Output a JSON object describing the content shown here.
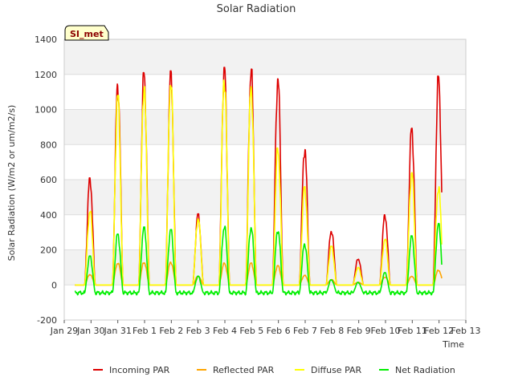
{
  "chart_data": {
    "type": "line",
    "title": "Solar Radiation",
    "xlabel": "Time",
    "ylabel": "Solar Radiation (W/m2 or um/m2/s)",
    "badge": "SI_met",
    "ylim": [
      -200,
      1400
    ],
    "yticks": [
      -200,
      0,
      200,
      400,
      600,
      800,
      1000,
      1200,
      1400
    ],
    "xlim": [
      0,
      15
    ],
    "xticks": [
      {
        "x": 0,
        "label": "Jan 29"
      },
      {
        "x": 1,
        "label": "Jan 30"
      },
      {
        "x": 2,
        "label": "Jan 31"
      },
      {
        "x": 3,
        "label": "Feb 1"
      },
      {
        "x": 4,
        "label": "Feb 2"
      },
      {
        "x": 5,
        "label": "Feb 3"
      },
      {
        "x": 6,
        "label": "Feb 4"
      },
      {
        "x": 7,
        "label": "Feb 5"
      },
      {
        "x": 8,
        "label": "Feb 6"
      },
      {
        "x": 9,
        "label": "Feb 7"
      },
      {
        "x": 10,
        "label": "Feb 8"
      },
      {
        "x": 11,
        "label": "Feb 9"
      },
      {
        "x": 12,
        "label": "Feb 10"
      },
      {
        "x": 13,
        "label": "Feb 11"
      },
      {
        "x": 14,
        "label": "Feb 12"
      },
      {
        "x": 15,
        "label": "Feb 13"
      }
    ],
    "start": 0.4,
    "end": 14.1,
    "grid": true,
    "legend_position": "bottom",
    "series": [
      {
        "name": "Incoming PAR",
        "color": "#dd0000",
        "night": 0,
        "peaks": [
          [
            0.96,
            610
          ],
          [
            2.0,
            1145
          ],
          [
            2.98,
            1210
          ],
          [
            3.98,
            1220
          ],
          [
            5.0,
            405
          ],
          [
            5.98,
            1240
          ],
          [
            6.98,
            1230
          ],
          [
            7.98,
            1178
          ],
          [
            8.98,
            780
          ],
          [
            9.98,
            310
          ],
          [
            10.98,
            150
          ],
          [
            11.98,
            400
          ],
          [
            12.98,
            893
          ],
          [
            13.98,
            1190
          ]
        ]
      },
      {
        "name": "Reflected PAR",
        "color": "#ffa500",
        "night": 0,
        "peaks": [
          [
            0.96,
            60
          ],
          [
            2.0,
            125
          ],
          [
            2.98,
            130
          ],
          [
            3.98,
            130
          ],
          [
            5.0,
            50
          ],
          [
            5.98,
            125
          ],
          [
            6.98,
            125
          ],
          [
            7.98,
            110
          ],
          [
            8.98,
            55
          ],
          [
            9.98,
            30
          ],
          [
            10.98,
            15
          ],
          [
            11.98,
            45
          ],
          [
            12.98,
            50
          ],
          [
            13.98,
            85
          ]
        ]
      },
      {
        "name": "Diffuse PAR",
        "color": "#ffff00",
        "night": 0,
        "peaks": [
          [
            0.96,
            420
          ],
          [
            2.0,
            1080
          ],
          [
            2.98,
            1130
          ],
          [
            3.98,
            1170
          ],
          [
            5.0,
            380
          ],
          [
            5.98,
            1180
          ],
          [
            6.98,
            1130
          ],
          [
            7.98,
            780
          ],
          [
            8.98,
            560
          ],
          [
            9.98,
            220
          ],
          [
            10.98,
            100
          ],
          [
            11.98,
            260
          ],
          [
            12.98,
            640
          ],
          [
            13.98,
            560
          ]
        ]
      },
      {
        "name": "Net Radiation",
        "color": "#00ee00",
        "night": -45,
        "peaks": [
          [
            0.96,
            165
          ],
          [
            2.0,
            290
          ],
          [
            2.98,
            330
          ],
          [
            3.98,
            315
          ],
          [
            5.0,
            50
          ],
          [
            5.98,
            335
          ],
          [
            6.98,
            330
          ],
          [
            7.98,
            315
          ],
          [
            8.98,
            235
          ],
          [
            9.98,
            30
          ],
          [
            10.98,
            15
          ],
          [
            11.98,
            70
          ],
          [
            12.98,
            280
          ],
          [
            13.98,
            350
          ]
        ]
      }
    ]
  }
}
